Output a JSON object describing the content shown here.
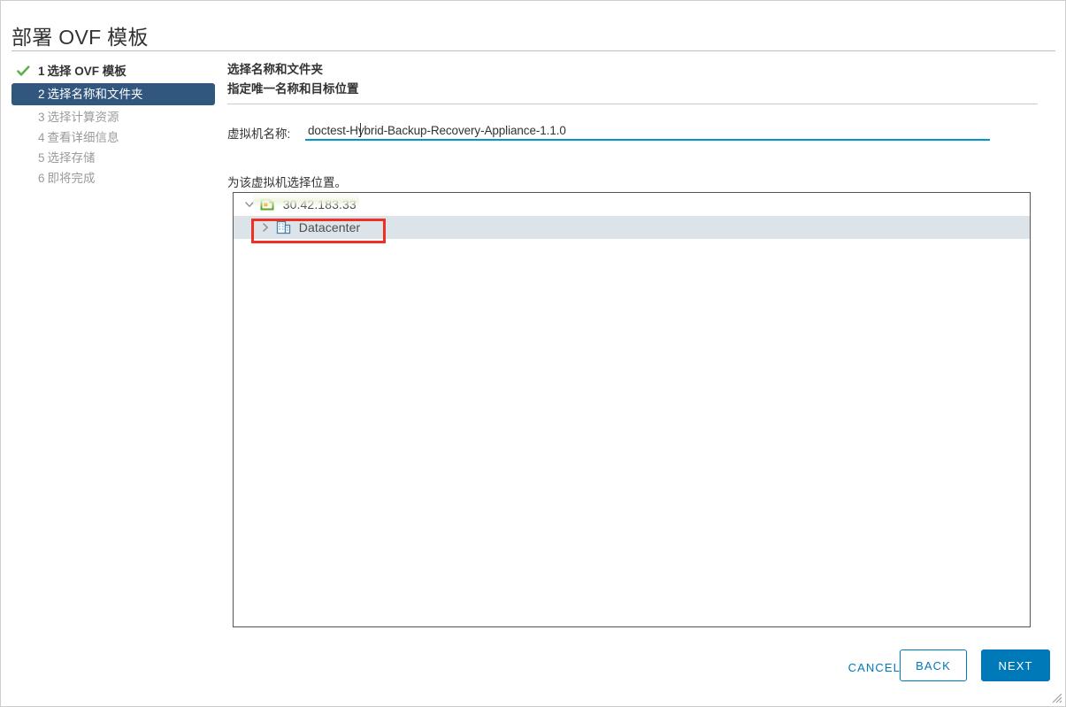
{
  "window": {
    "title": "部署 OVF 模板"
  },
  "steps": [
    {
      "num": "1",
      "label": "选择 OVF 模板",
      "state": "done"
    },
    {
      "num": "2",
      "label": "选择名称和文件夹",
      "state": "active"
    },
    {
      "num": "3",
      "label": "选择计算资源",
      "state": "pending"
    },
    {
      "num": "4",
      "label": "查看详细信息",
      "state": "pending"
    },
    {
      "num": "5",
      "label": "选择存储",
      "state": "pending"
    },
    {
      "num": "6",
      "label": "即将完成",
      "state": "pending"
    }
  ],
  "content": {
    "heading": "选择名称和文件夹",
    "subheading": "指定唯一名称和目标位置",
    "name_label": "虚拟机名称:",
    "name_value": "doctest-Hybrid-Backup-Recovery-Appliance-1.1.0",
    "name_placeholder": "",
    "location_label": "为该虚拟机选择位置。"
  },
  "tree": {
    "nodes": [
      {
        "label": "30.42.183.33",
        "icon": "vcenter-server-icon",
        "expanded": true,
        "selected": false,
        "redacted": true
      },
      {
        "label": "Datacenter",
        "icon": "datacenter-icon",
        "expanded": false,
        "selected": true,
        "redacted": false
      }
    ]
  },
  "footer": {
    "cancel_label": "CANCEL",
    "back_label": "BACK",
    "next_label": "NEXT"
  },
  "colors": {
    "accent": "#0079b8",
    "active_step_bg": "#31577e",
    "selected_row_bg": "#dce3e9",
    "annotation": "#ee3124",
    "input_underline": "#0095d3",
    "check_green": "#5eb14a"
  }
}
